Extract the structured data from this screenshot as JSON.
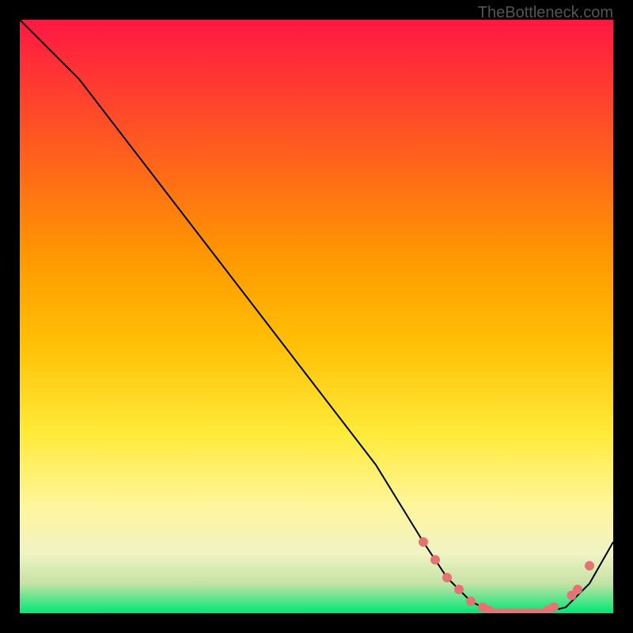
{
  "watermark": "TheBottleneck.com",
  "chart_data": {
    "type": "line",
    "title": "",
    "xlabel": "",
    "ylabel": "",
    "xlim": [
      0,
      100
    ],
    "ylim": [
      0,
      100
    ],
    "gradient_stops": [
      {
        "offset": 0,
        "color": "#ff1744"
      },
      {
        "offset": 20,
        "color": "#ff5722"
      },
      {
        "offset": 40,
        "color": "#ff9800"
      },
      {
        "offset": 55,
        "color": "#ffc107"
      },
      {
        "offset": 70,
        "color": "#ffeb3b"
      },
      {
        "offset": 82,
        "color": "#fff59d"
      },
      {
        "offset": 90,
        "color": "#f0f4c3"
      },
      {
        "offset": 95,
        "color": "#c5e1a5"
      },
      {
        "offset": 100,
        "color": "#00e676"
      }
    ],
    "series": [
      {
        "name": "bottleneck-curve",
        "color": "#000000",
        "x": [
          0,
          5,
          10,
          20,
          30,
          40,
          50,
          60,
          68,
          72,
          76,
          80,
          84,
          88,
          92,
          96,
          100
        ],
        "y": [
          100,
          95,
          90,
          77,
          64,
          51,
          38,
          25,
          12,
          6,
          2,
          0,
          0,
          0,
          1,
          5,
          12
        ]
      }
    ],
    "markers": {
      "name": "data-points",
      "color": "#e57373",
      "x": [
        68,
        70,
        72,
        74,
        76,
        78,
        79,
        80,
        81,
        82,
        83,
        84,
        85,
        86,
        87,
        88,
        89,
        90,
        93,
        94,
        96
      ],
      "y": [
        12,
        9,
        6,
        4,
        2,
        1,
        0.5,
        0,
        0,
        0,
        0,
        0,
        0,
        0,
        0,
        0,
        0.5,
        1,
        3,
        4,
        8
      ]
    }
  }
}
